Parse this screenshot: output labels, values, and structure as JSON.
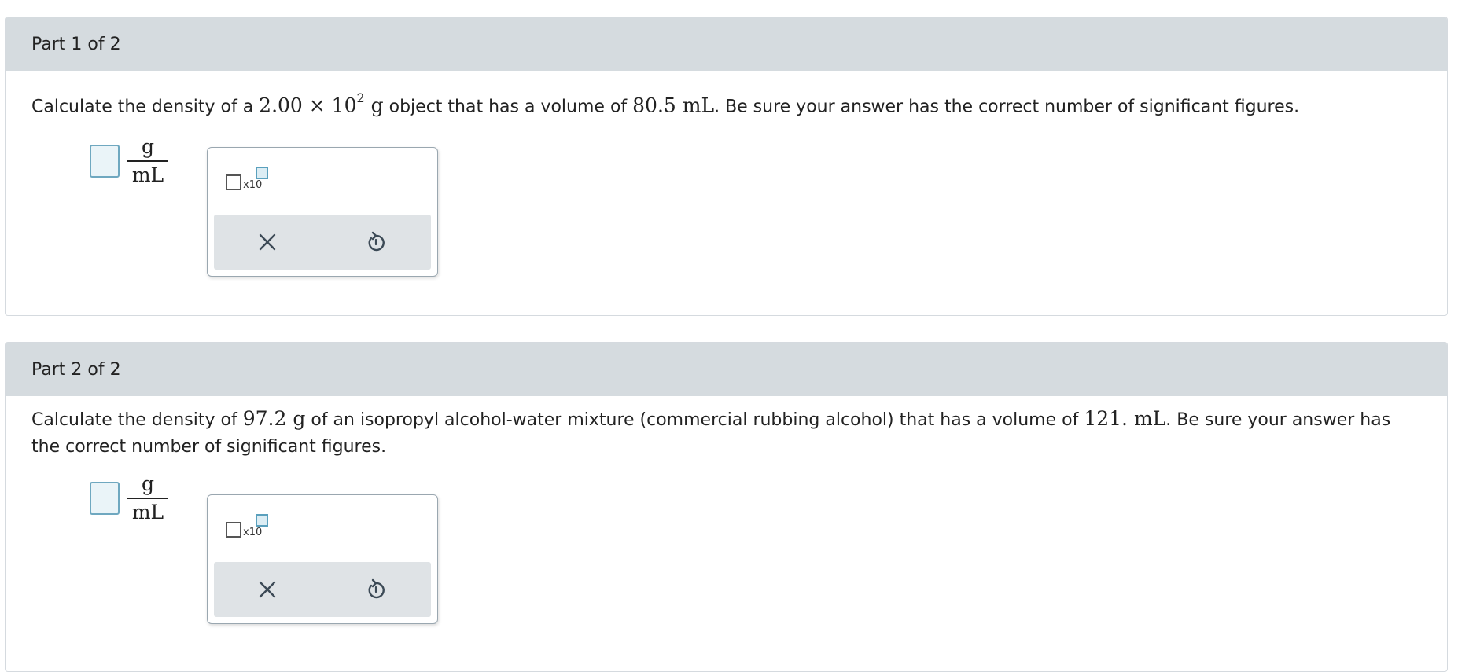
{
  "parts": [
    {
      "header": "Part 1 of 2",
      "question": {
        "t1": "Calculate the density of a ",
        "mass_mantissa": "2.00",
        "times": " × 10",
        "exponent": "2",
        "mass_unit": " g",
        "t2": " object that has a volume of ",
        "volume": "80.5",
        "volume_unit": " mL",
        "t3": ". Be sure your answer has the correct number of significant figures."
      },
      "answer": {
        "value": "",
        "unit_numerator": "g",
        "unit_denominator": "mL"
      },
      "tools": {
        "sci_label": "x10"
      }
    },
    {
      "header": "Part 2 of 2",
      "question": {
        "t1": "Calculate the density of ",
        "mass": "97.2",
        "mass_unit": " g",
        "t2": " of an isopropyl alcohol-water mixture (commercial rubbing alcohol) that has a volume of ",
        "volume": "121.",
        "volume_unit": " mL",
        "t3": ". Be sure your answer has the correct number of significant figures."
      },
      "answer": {
        "value": "",
        "unit_numerator": "g",
        "unit_denominator": "mL"
      },
      "tools": {
        "sci_label": "x10"
      }
    }
  ],
  "icons": {
    "clear": "close-icon",
    "undo": "undo-icon"
  },
  "colors": {
    "header_bg": "#d5dbdf",
    "answer_border": "#6fa8c0",
    "answer_fill": "#eaf4f8",
    "action_bar_bg": "#dfe3e6"
  }
}
